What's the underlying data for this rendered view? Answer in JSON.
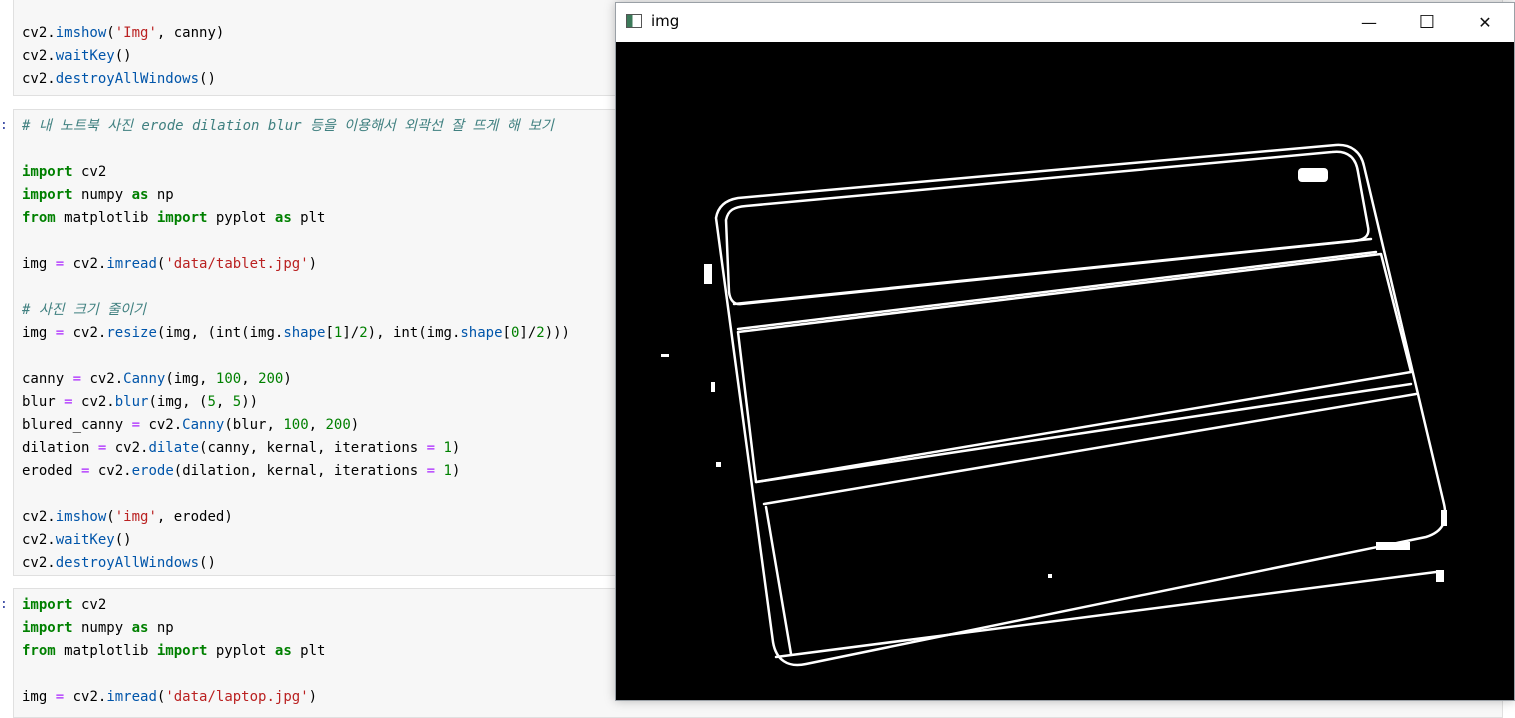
{
  "notebook": {
    "cell_prompts": [
      ":",
      ":"
    ],
    "cell_top": [
      "cv2.imshow('Img', canny)",
      "cv2.waitKey()",
      "cv2.destroyAllWindows()"
    ],
    "cell_mid": [
      "# 내 노트북 사진 erode dilation blur 등을 이용해서 외곽선 잘 뜨게 해 보기",
      "",
      "import cv2",
      "import numpy as np",
      "from matplotlib import pyplot as plt",
      "",
      "img = cv2.imread('data/tablet.jpg')",
      "",
      "# 사진 크기 줄이기",
      "img = cv2.resize(img, (int(img.shape[1]/2), int(img.shape[0]/2)))",
      "",
      "canny = cv2.Canny(img, 100, 200)",
      "blur = cv2.blur(img, (5, 5))",
      "blured_canny = cv2.Canny(blur, 100, 200)",
      "dilation = cv2.dilate(canny, kernal, iterations = 1)",
      "eroded = cv2.erode(dilation, kernal, iterations = 1)",
      "",
      "cv2.imshow('img', eroded)",
      "cv2.waitKey()",
      "cv2.destroyAllWindows()"
    ],
    "cell_bottom": [
      "import cv2",
      "import numpy as np",
      "from matplotlib import pyplot as plt",
      "",
      "img = cv2.imread('data/laptop.jpg')"
    ]
  },
  "window": {
    "title": "img",
    "minimize_glyph": "—",
    "maximize_glyph": "☐",
    "close_glyph": "✕",
    "icons": {
      "app": "opencv-window-icon",
      "minimize": "minimize-icon",
      "maximize": "maximize-icon",
      "close": "close-icon"
    }
  },
  "colors": {
    "image_background": "#000000",
    "edges": "#ffffff",
    "cell_background": "#f7f7f7"
  }
}
